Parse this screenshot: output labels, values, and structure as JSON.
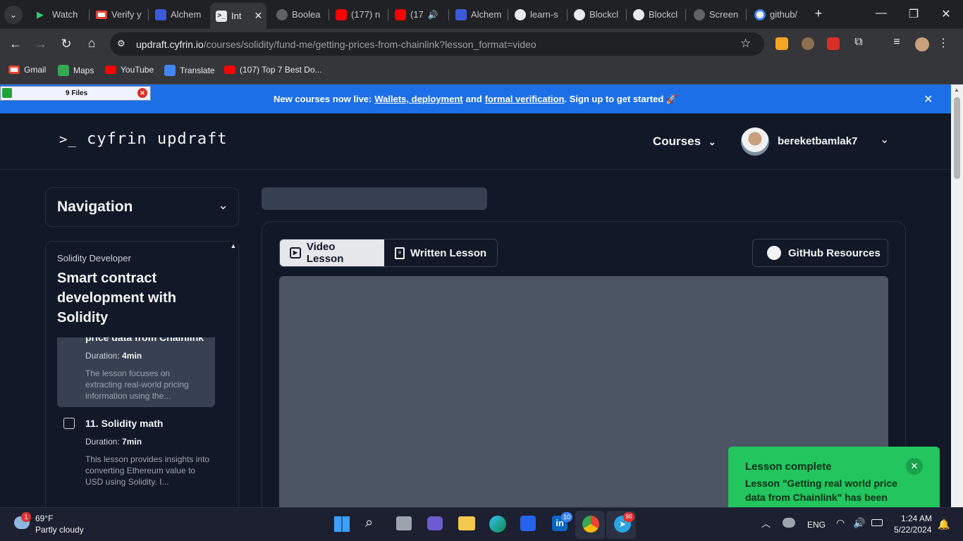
{
  "browser": {
    "tabs": [
      {
        "label": "Watch",
        "color": "#2ecc71"
      },
      {
        "label": "Verify y",
        "color": "#ea4335"
      },
      {
        "label": "Alchem",
        "color": "#3b5bdb"
      },
      {
        "label": "Int",
        "color": "#e8eaed",
        "active": true
      },
      {
        "label": "Boolea",
        "color": "#9aa0a6"
      },
      {
        "label": "(177) n",
        "color": "#ff0000"
      },
      {
        "label": "(17",
        "color": "#ff0000"
      },
      {
        "label": "Alchem",
        "color": "#3b5bdb"
      },
      {
        "label": "learn-s",
        "color": "#e8eaed"
      },
      {
        "label": "Blockcl",
        "color": "#e8eaed"
      },
      {
        "label": "Blockcl",
        "color": "#e8eaed"
      },
      {
        "label": "Screen",
        "color": "#9aa0a6"
      },
      {
        "label": "github/",
        "color": "#4285f4"
      }
    ],
    "url_host": "updraft.cyfrin.io",
    "url_path": "/courses/solidity/fund-me/getting-prices-from-chainlink?lesson_format=video",
    "bookmarks": [
      {
        "label": "Gmail",
        "color": "#ea4335"
      },
      {
        "label": "Maps",
        "color": "#34a853"
      },
      {
        "label": "YouTube",
        "color": "#ff0000"
      },
      {
        "label": "Translate",
        "color": "#4285f4"
      },
      {
        "label": "(107) Top 7 Best Do...",
        "color": "#ff0000"
      }
    ]
  },
  "filebar": {
    "label": "9 Files"
  },
  "banner": {
    "prefix": "New courses now live:",
    "link1": "Wallets, deployment",
    "middle": "and",
    "link2": "formal verification",
    "suffix": ". Sign up to get started 🚀"
  },
  "header": {
    "logo_prompt": ">_",
    "logo_text": "cyfrin updraft",
    "courses_label": "Courses",
    "username": "bereketbamlak7"
  },
  "navigation": {
    "title": "Navigation"
  },
  "course": {
    "category": "Solidity Developer",
    "title": "Smart contract development with Solidity",
    "lessons": [
      {
        "title_partial": "price data from Chainlink",
        "duration_label": "Duration:",
        "duration": "4min",
        "summary": "The lesson focuses on extracting real-world pricing information using the..."
      },
      {
        "title": "11. Solidity math",
        "duration_label": "Duration:",
        "duration": "7min",
        "summary": "This lesson provides insights into converting Ethereum value to USD using Solidity. I..."
      }
    ]
  },
  "lesson_view": {
    "video_tab": "Video Lesson",
    "written_tab": "Written Lesson",
    "github_button": "GitHub Resources"
  },
  "toast": {
    "title": "Lesson complete",
    "body": "Lesson \"Getting real world price data from Chainlink\" has been marked as complete"
  },
  "taskbar": {
    "temperature": "69°F",
    "weather": "Partly cloudy",
    "weather_badge": "1",
    "language": "ENG",
    "time": "1:24 AM",
    "date": "5/22/2024",
    "linkedin_badge": "10",
    "telegram_badge": "90"
  },
  "colors": {
    "banner": "#1d6fe8",
    "toast": "#22c55e",
    "page_bg": "#111827"
  }
}
